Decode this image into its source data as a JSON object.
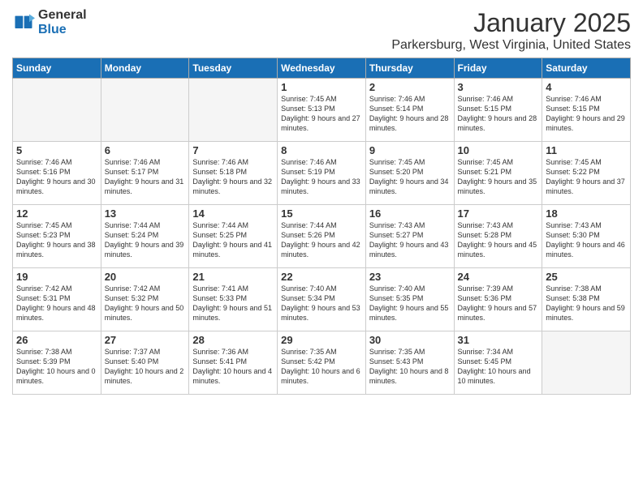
{
  "logo": {
    "general": "General",
    "blue": "Blue"
  },
  "header": {
    "month": "January 2025",
    "location": "Parkersburg, West Virginia, United States"
  },
  "weekdays": [
    "Sunday",
    "Monday",
    "Tuesday",
    "Wednesday",
    "Thursday",
    "Friday",
    "Saturday"
  ],
  "weeks": [
    [
      {
        "day": "",
        "info": ""
      },
      {
        "day": "",
        "info": ""
      },
      {
        "day": "",
        "info": ""
      },
      {
        "day": "1",
        "info": "Sunrise: 7:45 AM\nSunset: 5:13 PM\nDaylight: 9 hours and 27 minutes."
      },
      {
        "day": "2",
        "info": "Sunrise: 7:46 AM\nSunset: 5:14 PM\nDaylight: 9 hours and 28 minutes."
      },
      {
        "day": "3",
        "info": "Sunrise: 7:46 AM\nSunset: 5:15 PM\nDaylight: 9 hours and 28 minutes."
      },
      {
        "day": "4",
        "info": "Sunrise: 7:46 AM\nSunset: 5:15 PM\nDaylight: 9 hours and 29 minutes."
      }
    ],
    [
      {
        "day": "5",
        "info": "Sunrise: 7:46 AM\nSunset: 5:16 PM\nDaylight: 9 hours and 30 minutes."
      },
      {
        "day": "6",
        "info": "Sunrise: 7:46 AM\nSunset: 5:17 PM\nDaylight: 9 hours and 31 minutes."
      },
      {
        "day": "7",
        "info": "Sunrise: 7:46 AM\nSunset: 5:18 PM\nDaylight: 9 hours and 32 minutes."
      },
      {
        "day": "8",
        "info": "Sunrise: 7:46 AM\nSunset: 5:19 PM\nDaylight: 9 hours and 33 minutes."
      },
      {
        "day": "9",
        "info": "Sunrise: 7:45 AM\nSunset: 5:20 PM\nDaylight: 9 hours and 34 minutes."
      },
      {
        "day": "10",
        "info": "Sunrise: 7:45 AM\nSunset: 5:21 PM\nDaylight: 9 hours and 35 minutes."
      },
      {
        "day": "11",
        "info": "Sunrise: 7:45 AM\nSunset: 5:22 PM\nDaylight: 9 hours and 37 minutes."
      }
    ],
    [
      {
        "day": "12",
        "info": "Sunrise: 7:45 AM\nSunset: 5:23 PM\nDaylight: 9 hours and 38 minutes."
      },
      {
        "day": "13",
        "info": "Sunrise: 7:44 AM\nSunset: 5:24 PM\nDaylight: 9 hours and 39 minutes."
      },
      {
        "day": "14",
        "info": "Sunrise: 7:44 AM\nSunset: 5:25 PM\nDaylight: 9 hours and 41 minutes."
      },
      {
        "day": "15",
        "info": "Sunrise: 7:44 AM\nSunset: 5:26 PM\nDaylight: 9 hours and 42 minutes."
      },
      {
        "day": "16",
        "info": "Sunrise: 7:43 AM\nSunset: 5:27 PM\nDaylight: 9 hours and 43 minutes."
      },
      {
        "day": "17",
        "info": "Sunrise: 7:43 AM\nSunset: 5:28 PM\nDaylight: 9 hours and 45 minutes."
      },
      {
        "day": "18",
        "info": "Sunrise: 7:43 AM\nSunset: 5:30 PM\nDaylight: 9 hours and 46 minutes."
      }
    ],
    [
      {
        "day": "19",
        "info": "Sunrise: 7:42 AM\nSunset: 5:31 PM\nDaylight: 9 hours and 48 minutes."
      },
      {
        "day": "20",
        "info": "Sunrise: 7:42 AM\nSunset: 5:32 PM\nDaylight: 9 hours and 50 minutes."
      },
      {
        "day": "21",
        "info": "Sunrise: 7:41 AM\nSunset: 5:33 PM\nDaylight: 9 hours and 51 minutes."
      },
      {
        "day": "22",
        "info": "Sunrise: 7:40 AM\nSunset: 5:34 PM\nDaylight: 9 hours and 53 minutes."
      },
      {
        "day": "23",
        "info": "Sunrise: 7:40 AM\nSunset: 5:35 PM\nDaylight: 9 hours and 55 minutes."
      },
      {
        "day": "24",
        "info": "Sunrise: 7:39 AM\nSunset: 5:36 PM\nDaylight: 9 hours and 57 minutes."
      },
      {
        "day": "25",
        "info": "Sunrise: 7:38 AM\nSunset: 5:38 PM\nDaylight: 9 hours and 59 minutes."
      }
    ],
    [
      {
        "day": "26",
        "info": "Sunrise: 7:38 AM\nSunset: 5:39 PM\nDaylight: 10 hours and 0 minutes."
      },
      {
        "day": "27",
        "info": "Sunrise: 7:37 AM\nSunset: 5:40 PM\nDaylight: 10 hours and 2 minutes."
      },
      {
        "day": "28",
        "info": "Sunrise: 7:36 AM\nSunset: 5:41 PM\nDaylight: 10 hours and 4 minutes."
      },
      {
        "day": "29",
        "info": "Sunrise: 7:35 AM\nSunset: 5:42 PM\nDaylight: 10 hours and 6 minutes."
      },
      {
        "day": "30",
        "info": "Sunrise: 7:35 AM\nSunset: 5:43 PM\nDaylight: 10 hours and 8 minutes."
      },
      {
        "day": "31",
        "info": "Sunrise: 7:34 AM\nSunset: 5:45 PM\nDaylight: 10 hours and 10 minutes."
      },
      {
        "day": "",
        "info": ""
      }
    ]
  ]
}
